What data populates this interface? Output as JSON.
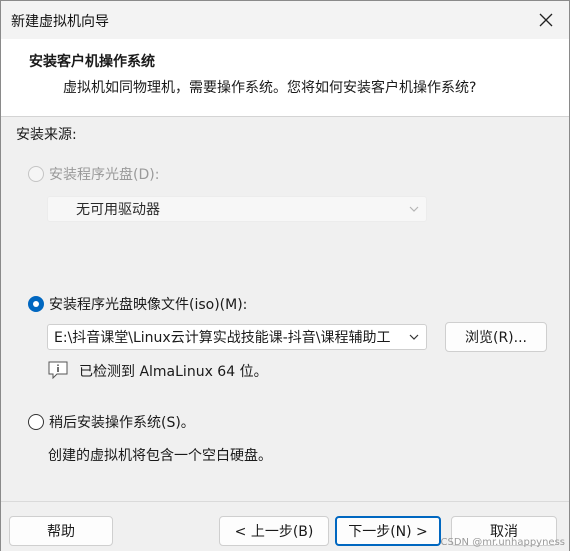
{
  "window": {
    "title": "新建虚拟机向导"
  },
  "header": {
    "title": "安装客户机操作系统",
    "subtitle": "虚拟机如同物理机，需要操作系统。您将如何安装客户机操作系统?"
  },
  "install_source": {
    "label": "安装来源:",
    "options": [
      {
        "label": "安装程序光盘(D):",
        "selected": false,
        "enabled": false
      },
      {
        "label": "安装程序光盘映像文件(iso)(M):",
        "selected": true,
        "enabled": true
      },
      {
        "label": "稍后安装操作系统(S)。",
        "selected": false,
        "enabled": true
      }
    ],
    "drive_select": {
      "value": "无可用驱动器"
    },
    "iso_select": {
      "value": "E:\\抖音课堂\\Linux云计算实战技能课-抖音\\课程辅助工"
    },
    "browse_label": "浏览(R)...",
    "detected_text": "已检测到 AlmaLinux 64 位。",
    "later_desc": "创建的虚拟机将包含一个空白硬盘。"
  },
  "footer": {
    "help_label": "帮助",
    "back_label": "< 上一步(B)",
    "next_label": "下一步(N) >",
    "cancel_label": "取消"
  },
  "watermark": "CSDN @mr.unhappyness",
  "icons": {
    "close": "close-icon",
    "chevron": "chevron-down-icon",
    "info": "info-icon"
  },
  "colors": {
    "accent": "#0067c0"
  }
}
